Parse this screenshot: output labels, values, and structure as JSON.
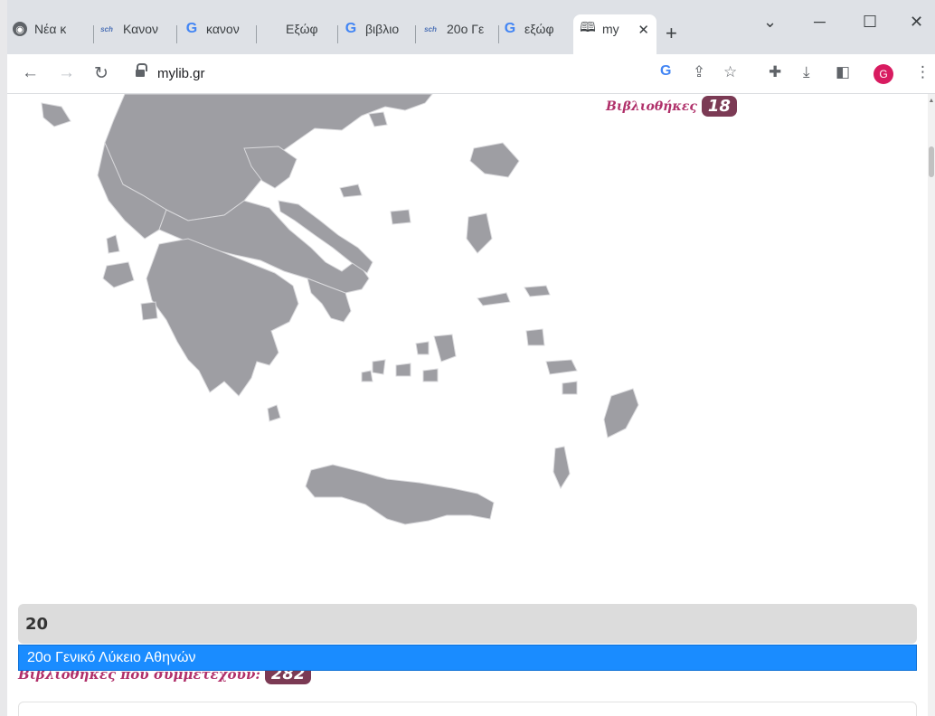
{
  "browser": {
    "tabs": [
      {
        "label": "Νέα κ",
        "icon": "chrome-icon",
        "active": false
      },
      {
        "label": "Κανον",
        "icon": "sch-icon",
        "active": false
      },
      {
        "label": "κανον",
        "icon": "google-icon",
        "active": false
      },
      {
        "label": "Εξώφ",
        "icon": "microsoft-icon",
        "active": false
      },
      {
        "label": "βιβλιο",
        "icon": "google-icon",
        "active": false
      },
      {
        "label": "20ο Γε",
        "icon": "sch-icon",
        "active": false
      },
      {
        "label": "εξώφ",
        "icon": "google-icon",
        "active": false
      },
      {
        "label": "my",
        "icon": "book-icon",
        "active": true
      }
    ],
    "url": "mylib.gr",
    "profile_initial": "G",
    "new_tab_symbol": "+",
    "close_symbol": "✕"
  },
  "map": {
    "fill_color": "#9e9ea3",
    "border_color": "#d9d9dc"
  },
  "libraries_top": {
    "label": "Βιβλιοθήκες",
    "count": "18"
  },
  "search": {
    "value": "20"
  },
  "autocomplete": {
    "items": [
      "20ο Γενικό Λύκειο Αθηνών"
    ]
  },
  "libraries_participating": {
    "label": "Βιβλιοθήκες που συμμετέχουν:",
    "count": "282"
  },
  "colors": {
    "accent_pink": "#b0306a",
    "badge": "#7b3a54",
    "highlight": "#1a8cff"
  }
}
